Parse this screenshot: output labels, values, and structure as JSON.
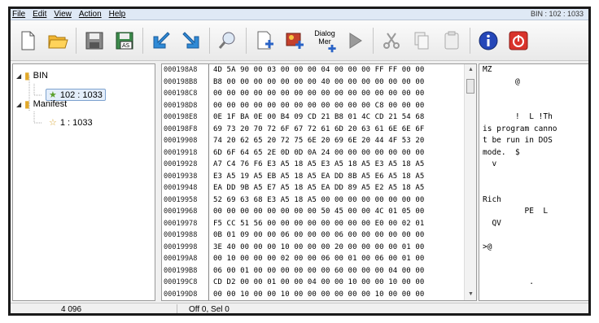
{
  "menu": {
    "items": [
      "File",
      "Edit",
      "View",
      "Action",
      "Help"
    ],
    "right_text": "BIN : 102 : 1033"
  },
  "toolbar": {
    "dialog_merge_label_1": "Dialog",
    "dialog_merge_label_2": "Mer"
  },
  "tree": {
    "root1": "BIN",
    "child1": "102 : 1033",
    "root2": "Manifest",
    "child2": "1 : 1033"
  },
  "hex": {
    "addresses": [
      "000198A8",
      "000198B8",
      "000198C8",
      "000198D8",
      "000198E8",
      "000198F8",
      "00019908",
      "00019918",
      "00019928",
      "00019938",
      "00019948",
      "00019958",
      "00019968",
      "00019978",
      "00019988",
      "00019998",
      "000199A8",
      "000199B8",
      "000199C8",
      "000199D8"
    ],
    "rows": [
      "4D 5A 90 00 03 00 00 00 04 00 00 00 FF FF 00 00",
      "B8 00 00 00 00 00 00 00 40 00 00 00 00 00 00 00",
      "00 00 00 00 00 00 00 00 00 00 00 00 00 00 00 00",
      "00 00 00 00 00 00 00 00 00 00 00 00 C8 00 00 00",
      "0E 1F BA 0E 00 B4 09 CD 21 B8 01 4C CD 21 54 68",
      "69 73 20 70 72 6F 67 72 61 6D 20 63 61 6E 6E 6F",
      "74 20 62 65 20 72 75 6E 20 69 6E 20 44 4F 53 20",
      "6D 6F 64 65 2E 0D 0D 0A 24 00 00 00 00 00 00 00",
      "A7 C4 76 F6 E3 A5 18 A5 E3 A5 18 A5 E3 A5 18 A5",
      "E3 A5 19 A5 EB A5 18 A5 EA DD 8B A5 E6 A5 18 A5",
      "EA DD 9B A5 E7 A5 18 A5 EA DD 89 A5 E2 A5 18 A5",
      "52 69 63 68 E3 A5 18 A5 00 00 00 00 00 00 00 00",
      "00 00 00 00 00 00 00 00 50 45 00 00 4C 01 05 00",
      "F5 CC 51 56 00 00 00 00 00 00 00 00 E0 00 02 01",
      "0B 01 09 00 00 06 00 00 00 06 00 00 00 00 00 00",
      "3E 40 00 00 00 10 00 00 00 20 00 00 00 00 01 00",
      "00 10 00 00 00 02 00 00 06 00 01 00 06 00 01 00",
      "06 00 01 00 00 00 00 00 00 60 00 00 00 04 00 00",
      "CD D2 00 00 01 00 00 04 00 00 10 00 00 10 00 00",
      "00 00 10 00 00 10 00 00 00 00 00 00 10 00 00 00"
    ]
  },
  "ascii": {
    "rows": [
      "MZ",
      "       @",
      "",
      "",
      "       !  L !Th",
      "is program canno",
      "t be run in DOS",
      "mode.  $",
      "  v",
      "",
      "",
      "Rich",
      "         PE  L",
      "  QV",
      "",
      ">@",
      "",
      "",
      "          .",
      ""
    ]
  },
  "status": {
    "size": "4 096",
    "offset": "Off 0, Sel 0"
  }
}
